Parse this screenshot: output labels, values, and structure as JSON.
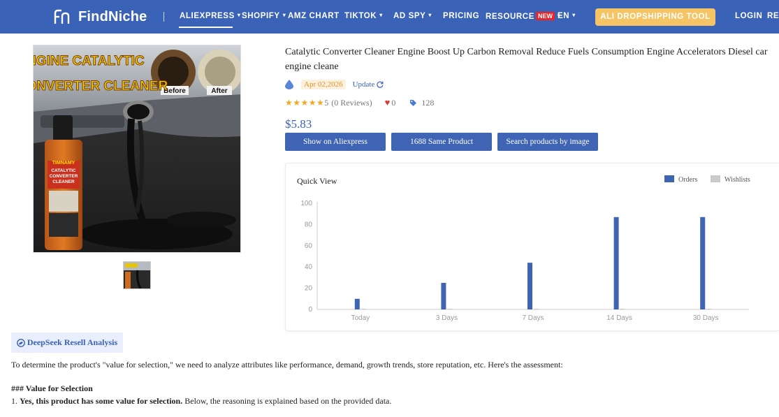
{
  "nav": {
    "brand": "FindNiche",
    "items": [
      {
        "label": "ALIEXPRESS",
        "caret": "▾"
      },
      {
        "label": "SHOPIFY",
        "caret": "▾"
      },
      {
        "label": "AMZ CHART",
        "caret": ""
      },
      {
        "label": "TIKTOK",
        "caret": "▾"
      },
      {
        "label": "AD SPY",
        "caret": "▾"
      },
      {
        "label": "PRICING",
        "caret": ""
      },
      {
        "label": "RESOURCE",
        "caret": "▾",
        "badge": "NEW"
      },
      {
        "label": "EN",
        "caret": "▾"
      }
    ],
    "cta": "ALI DROPSHIPPING TOOL",
    "login": "LOGIN",
    "register": "REG"
  },
  "product": {
    "image_text": {
      "headline1": "ENGINE CATALYTIC",
      "headline2": "CONVERTER CLEANER",
      "before": "Before",
      "after": "After",
      "bottle_brand": "TIMNAMY",
      "bottle_line1": "CATALYTIC",
      "bottle_line2": "CONVERTER",
      "bottle_line3": "CLEANER"
    },
    "title_line1": "Catalytic Converter Cleaner Engine Boost Up Carbon Removal Reduce Fuels Consumption Engine Accelerators Diesel car",
    "title_line2": "engine cleane",
    "date": "Apr 02,2026",
    "update_label": "Update",
    "rating": "5",
    "stars": "★★★★★",
    "reviews": "(0 Reviews)",
    "likes": "0",
    "tags": "128",
    "price": "$5.83",
    "buttons": {
      "aliexpress": "Show on Aliexpress",
      "same": "1688 Same Product",
      "image_search": "Search products by image"
    }
  },
  "chart": {
    "title": "Quick View"
  },
  "chart_data": {
    "type": "bar",
    "categories": [
      "Today",
      "3 Days",
      "7 Days",
      "14 Days",
      "30 Days"
    ],
    "series": [
      {
        "name": "Orders",
        "values": [
          10,
          25,
          44,
          87,
          87
        ],
        "color": "#3e64b3"
      },
      {
        "name": "Wishlists",
        "values": [
          0,
          0,
          0,
          0,
          0
        ],
        "color": "#c8cad0"
      }
    ],
    "ylim": [
      0,
      100
    ],
    "yticks": [
      0,
      20,
      40,
      60,
      80,
      100
    ],
    "legend": "top-right",
    "grid": false
  },
  "deepseek": {
    "button": "DeepSeek Resell Analysis",
    "intro": "To determine the product's \"value for selection,\" we need to analyze attributes like performance, demand, growth trends, store reputation, etc. Here's the assessment:",
    "heading_prefix": "### ",
    "heading": "Value for Selection",
    "point_number": "1. ",
    "point_bold": "Yes, this product has some value for selection.",
    "point_rest": " Below, the reasoning is explained based on the provided data."
  }
}
